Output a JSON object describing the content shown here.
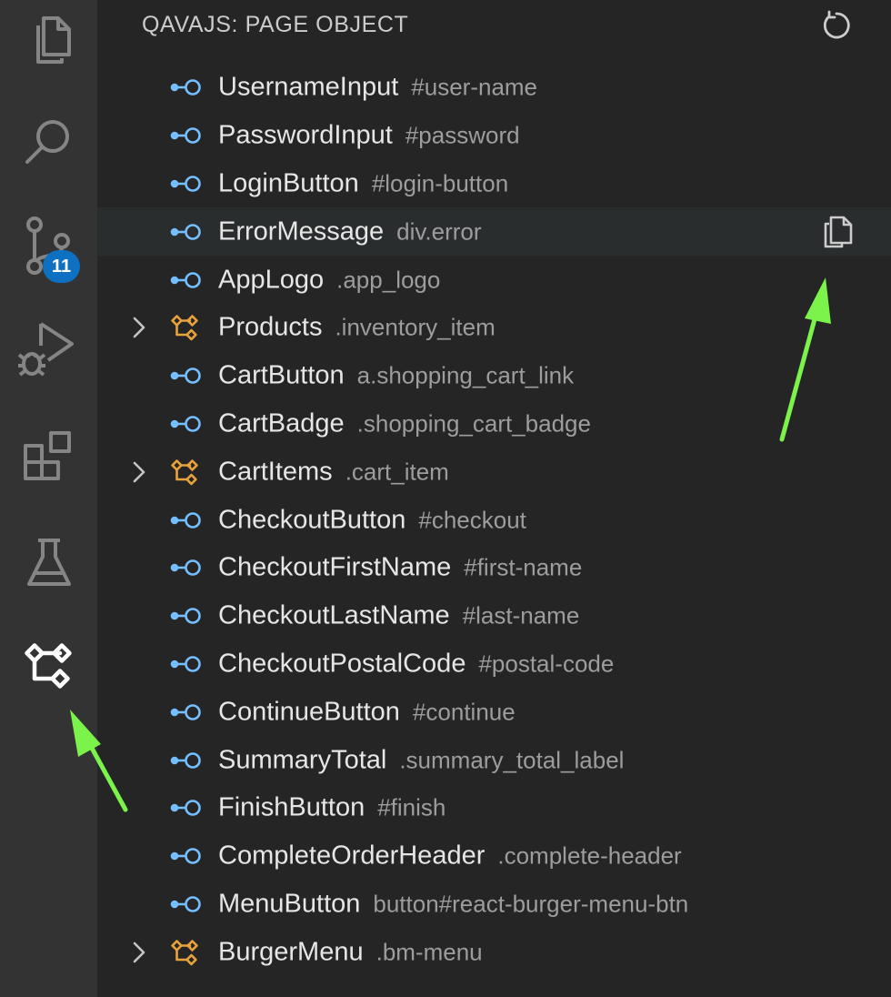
{
  "panel": {
    "title": "QAVAJS: PAGE OBJECT"
  },
  "activity_bar": {
    "items": [
      {
        "icon": "explorer-icon"
      },
      {
        "icon": "search-icon"
      },
      {
        "icon": "source-control-icon",
        "badge": "11"
      },
      {
        "icon": "run-debug-icon"
      },
      {
        "icon": "extensions-icon"
      },
      {
        "icon": "testing-icon"
      },
      {
        "icon": "qavajs-page-object-icon",
        "active": true
      }
    ]
  },
  "tree": {
    "rows": [
      {
        "name": "UsernameInput",
        "selector": "#user-name",
        "kind": "element"
      },
      {
        "name": "PasswordInput",
        "selector": "#password",
        "kind": "element"
      },
      {
        "name": "LoginButton",
        "selector": "#login-button",
        "kind": "element"
      },
      {
        "name": "ErrorMessage",
        "selector": "div.error",
        "kind": "element",
        "hovered": true
      },
      {
        "name": "AppLogo",
        "selector": ".app_logo",
        "kind": "element"
      },
      {
        "name": "Products",
        "selector": ".inventory_item",
        "kind": "component"
      },
      {
        "name": "CartButton",
        "selector": "a.shopping_cart_link",
        "kind": "element"
      },
      {
        "name": "CartBadge",
        "selector": ".shopping_cart_badge",
        "kind": "element"
      },
      {
        "name": "CartItems",
        "selector": ".cart_item",
        "kind": "component"
      },
      {
        "name": "CheckoutButton",
        "selector": "#checkout",
        "kind": "element"
      },
      {
        "name": "CheckoutFirstName",
        "selector": "#first-name",
        "kind": "element"
      },
      {
        "name": "CheckoutLastName",
        "selector": "#last-name",
        "kind": "element"
      },
      {
        "name": "CheckoutPostalCode",
        "selector": "#postal-code",
        "kind": "element"
      },
      {
        "name": "ContinueButton",
        "selector": "#continue",
        "kind": "element"
      },
      {
        "name": "SummaryTotal",
        "selector": ".summary_total_label",
        "kind": "element"
      },
      {
        "name": "FinishButton",
        "selector": "#finish",
        "kind": "element"
      },
      {
        "name": "CompleteOrderHeader",
        "selector": ".complete-header",
        "kind": "element"
      },
      {
        "name": "MenuButton",
        "selector": "button#react-burger-menu-btn",
        "kind": "element"
      },
      {
        "name": "BurgerMenu",
        "selector": ".bm-menu",
        "kind": "component"
      }
    ]
  },
  "colors": {
    "activity_bar_bg": "#333333",
    "sidebar_bg": "#252526",
    "element_icon": "#75beff",
    "component_icon": "#e8a33d",
    "badge_bg": "#0e70c0",
    "annotation_arrow": "#7cf34a"
  }
}
